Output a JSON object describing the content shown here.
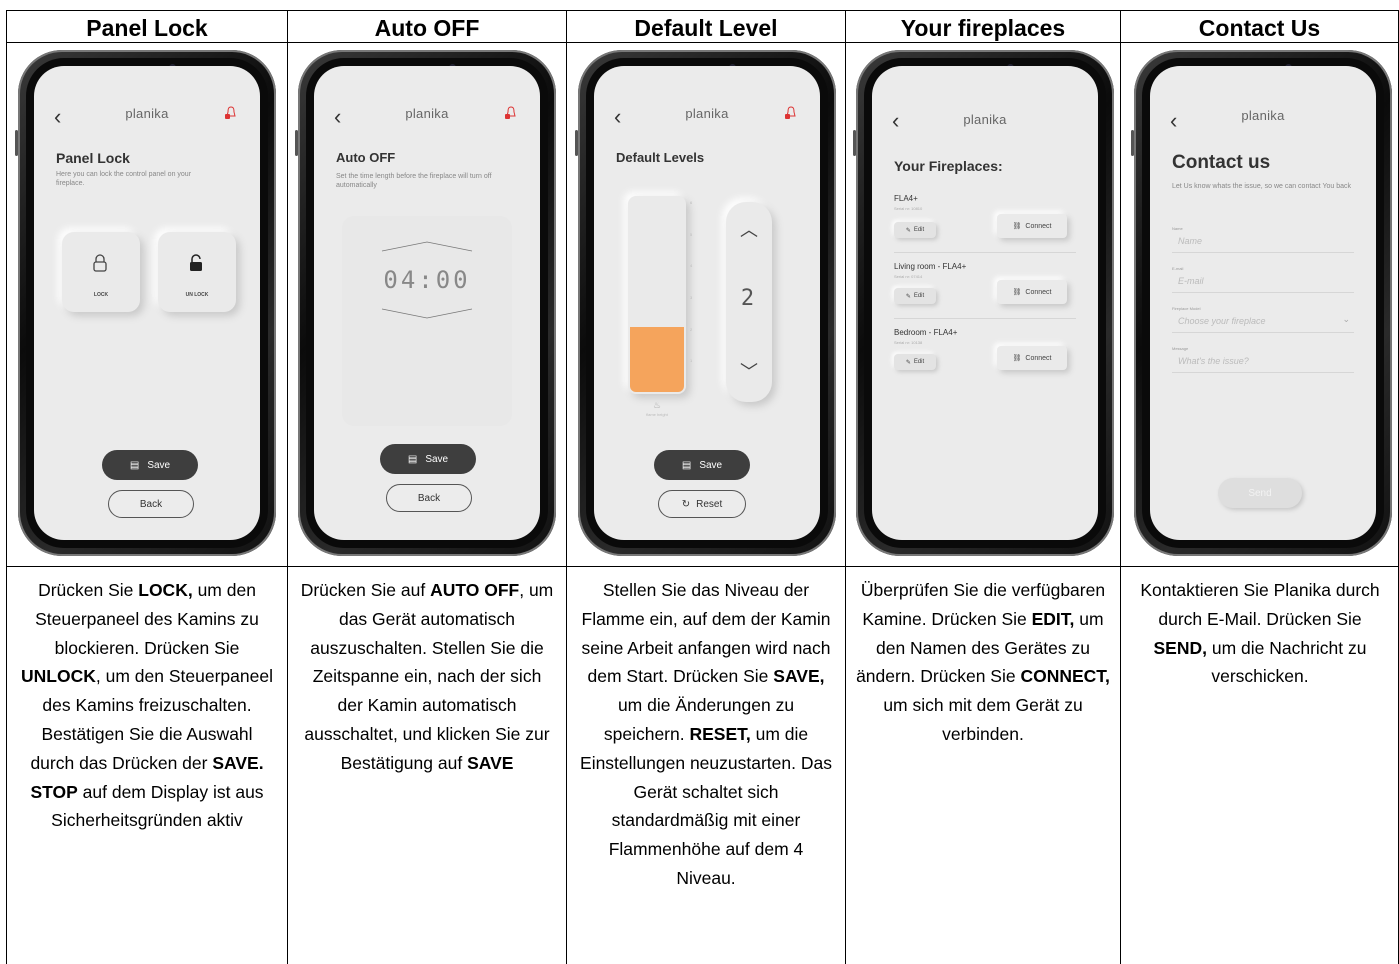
{
  "columns": [
    {
      "header": "Panel Lock",
      "screen": {
        "brand": "planika",
        "title": "Panel Lock",
        "subtitle": "Here you can lock the control panel on your fireplace.",
        "lock_label": "LOCK",
        "unlock_label": "UN LOCK",
        "save_label": "Save",
        "back_label": "Back"
      },
      "desc": [
        {
          "t": "Drücken Sie "
        },
        {
          "b": "LOCK,"
        },
        {
          "t": " um den Steuerpaneel des Kamins zu blockieren. Drücken Sie "
        },
        {
          "b": "UNLOCK"
        },
        {
          "t": ", um den Steuerpaneel des Kamins freizuschalten. Bestätigen Sie die Auswahl durch das Drücken der "
        },
        {
          "b": "SAVE."
        },
        {
          "t": " "
        },
        {
          "b": "STOP"
        },
        {
          "t": " auf dem Display ist aus Sicherheitsgründen aktiv"
        }
      ]
    },
    {
      "header": "Auto OFF",
      "screen": {
        "brand": "planika",
        "title": "Auto OFF",
        "subtitle": "Set the time length before the fireplace will turn off automatically",
        "time": "04:00",
        "save_label": "Save",
        "back_label": "Back"
      },
      "desc": [
        {
          "t": "Drücken Sie auf "
        },
        {
          "b": "AUTO OFF"
        },
        {
          "t": ", um das Gerät automatisch auszuschalten. Stellen Sie die Zeitspanne ein, nach der sich der Kamin automatisch ausschaltet, und klicken Sie zur Bestätigung auf "
        },
        {
          "b": "SAVE"
        }
      ]
    },
    {
      "header": "Default Level",
      "screen": {
        "brand": "planika",
        "title": "Default Levels",
        "level": "2",
        "level_fraction": 0.33,
        "scale_ticks": [
          "6",
          "5",
          "4",
          "3",
          "2",
          "1"
        ],
        "flame_caption": "flame height",
        "save_label": "Save",
        "reset_label": "Reset",
        "accent": "#f5a45c"
      },
      "desc": [
        {
          "t": "Stellen Sie das Niveau der Flamme ein, auf dem der Kamin seine Arbeit anfangen wird nach dem Start. Drücken Sie "
        },
        {
          "b": "SAVE,"
        },
        {
          "t": " um die Änderungen zu speichern. "
        },
        {
          "b": "RESET,"
        },
        {
          "t": "  um die Einstellungen neuzustarten. Das Gerät schaltet sich standardmäßig mit einer Flammenhöhe auf dem 4 Niveau."
        }
      ]
    },
    {
      "header": "Your fireplaces",
      "screen": {
        "brand": "planika",
        "title": "Your Fireplaces:",
        "fireplaces": [
          {
            "name": "FLA4+",
            "serial": "Serial nr: 10810",
            "edit": "Edit",
            "connect": "Connect"
          },
          {
            "name": "Living room - FLA4+",
            "serial": "Serial nr: 07414",
            "edit": "Edit",
            "connect": "Connect"
          },
          {
            "name": "Bedroom - FLA4+",
            "serial": "Serial nr: 10138",
            "edit": "Edit",
            "connect": "Connect"
          }
        ]
      },
      "desc": [
        {
          "t": "Überprüfen Sie die verfügbaren Kamine. Drücken Sie "
        },
        {
          "b": "EDIT,"
        },
        {
          "t": " um den Namen des Gerätes zu ändern. Drücken Sie "
        },
        {
          "b": "CONNECT,"
        },
        {
          "t": " um sich mit dem Gerät zu verbinden."
        }
      ]
    },
    {
      "header": "Contact Us",
      "screen": {
        "brand": "planika",
        "title": "Contact us",
        "subtitle": "Let Us know whats the issue, so we can contact You back",
        "name_label": "Name",
        "name_placeholder": "Name",
        "email_label": "E-mail",
        "email_placeholder": "E-mail",
        "model_label": "Fireplace Model",
        "model_placeholder": "Choose your fireplace",
        "message_label": "Message",
        "message_placeholder": "What's the issue?",
        "send_label": "Send"
      },
      "desc": [
        {
          "t": "Kontaktieren Sie Planika durch durch E-Mail. Drücken Sie "
        },
        {
          "b": "SEND,"
        },
        {
          "t": " um die Nachricht zu verschicken."
        }
      ]
    }
  ]
}
